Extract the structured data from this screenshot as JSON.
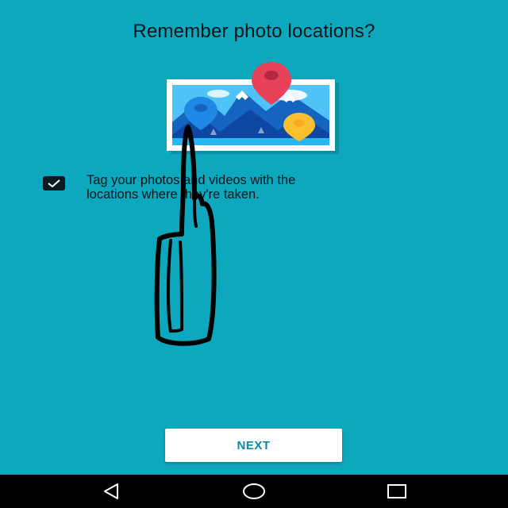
{
  "screen": {
    "title": "Remember photo locations?",
    "illustration_icon": "photo-with-location-pins",
    "option": {
      "checked": true,
      "line1": "Tag your photos and videos with the",
      "line2": "locations where they're taken."
    },
    "next_label": "NEXT"
  },
  "navigation_bar": {
    "back_icon": "back-triangle-icon",
    "home_icon": "home-circle-icon",
    "recents_icon": "recents-square-icon"
  },
  "colors": {
    "background": "#0ea8be",
    "pin_red": "#e8425a",
    "pin_blue": "#1e88e5",
    "pin_yellow": "#fbc02d",
    "button_text": "#0d8a9c",
    "nav_bar": "#000000"
  }
}
